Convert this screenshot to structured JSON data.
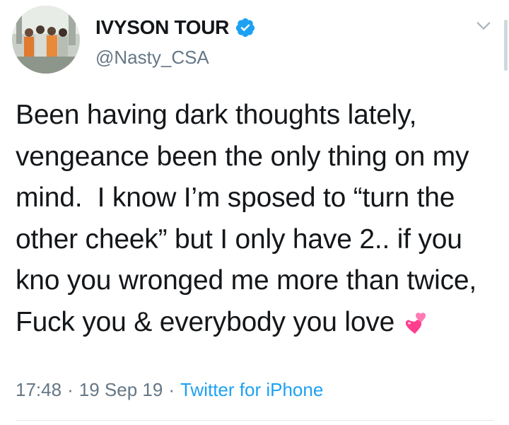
{
  "user": {
    "display_name": "IVYSON TOUR",
    "handle": "@Nasty_CSA",
    "verified": true,
    "avatar_icon": "group-photo-avatar"
  },
  "tweet": {
    "text": "Been having dark thoughts lately, vengeance been the only thing on my mind.  I know I’m sposed to “turn the other cheek” but I only have 2.. if you kno you wronged me more than twice, Fuck you & everybody you love ",
    "emoji": "two-hearts-emoji",
    "time": "17:48",
    "date": "19 Sep 19",
    "source": "Twitter for iPhone",
    "separator": "·"
  },
  "icons": {
    "menu": "chevron-down-icon",
    "verified": "verified-badge-icon"
  },
  "colors": {
    "text": "#14171a",
    "secondary": "#657786",
    "accent": "#1da1f2",
    "divider": "#e1e8ed"
  }
}
